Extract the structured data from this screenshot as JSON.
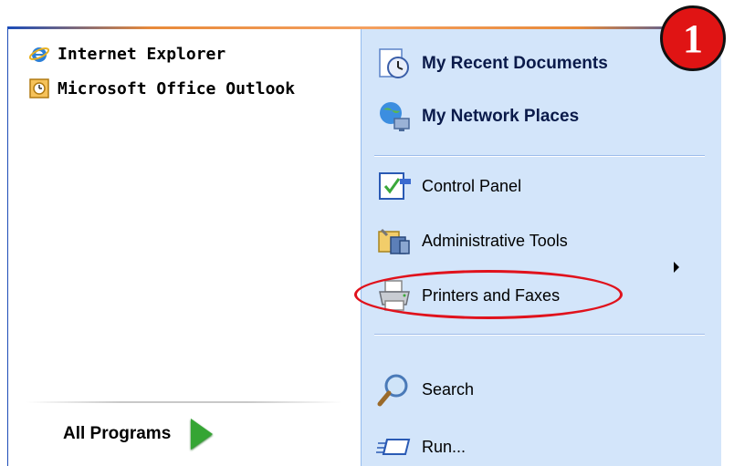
{
  "menu": {
    "left": {
      "pinned": [
        {
          "label": "Internet Explorer",
          "icon": "internet-explorer-icon"
        },
        {
          "label": "Microsoft Office Outlook",
          "icon": "outlook-icon"
        }
      ],
      "all_programs_label": "All Programs"
    },
    "right": {
      "places": [
        {
          "label": "My Recent Documents",
          "icon": "recent-documents-icon"
        },
        {
          "label": "My Network Places",
          "icon": "network-places-icon"
        }
      ],
      "tools": [
        {
          "label": "Control Panel",
          "icon": "control-panel-icon"
        },
        {
          "label": "Administrative Tools",
          "icon": "administrative-tools-icon"
        },
        {
          "label": "Printers and Faxes",
          "icon": "printer-icon"
        }
      ],
      "actions": [
        {
          "label": "Search",
          "icon": "search-icon"
        },
        {
          "label": "Run...",
          "icon": "run-icon"
        }
      ]
    }
  },
  "annotation": {
    "step_number": "1",
    "highlighted_item": "Printers and Faxes",
    "highlight_color": "#e0121c"
  },
  "colors": {
    "right_pane_bg": "#d3e5fa",
    "border_blue": "#1c4cb8",
    "accent_orange": "#e88a3a",
    "arrow_green": "#35a534"
  }
}
